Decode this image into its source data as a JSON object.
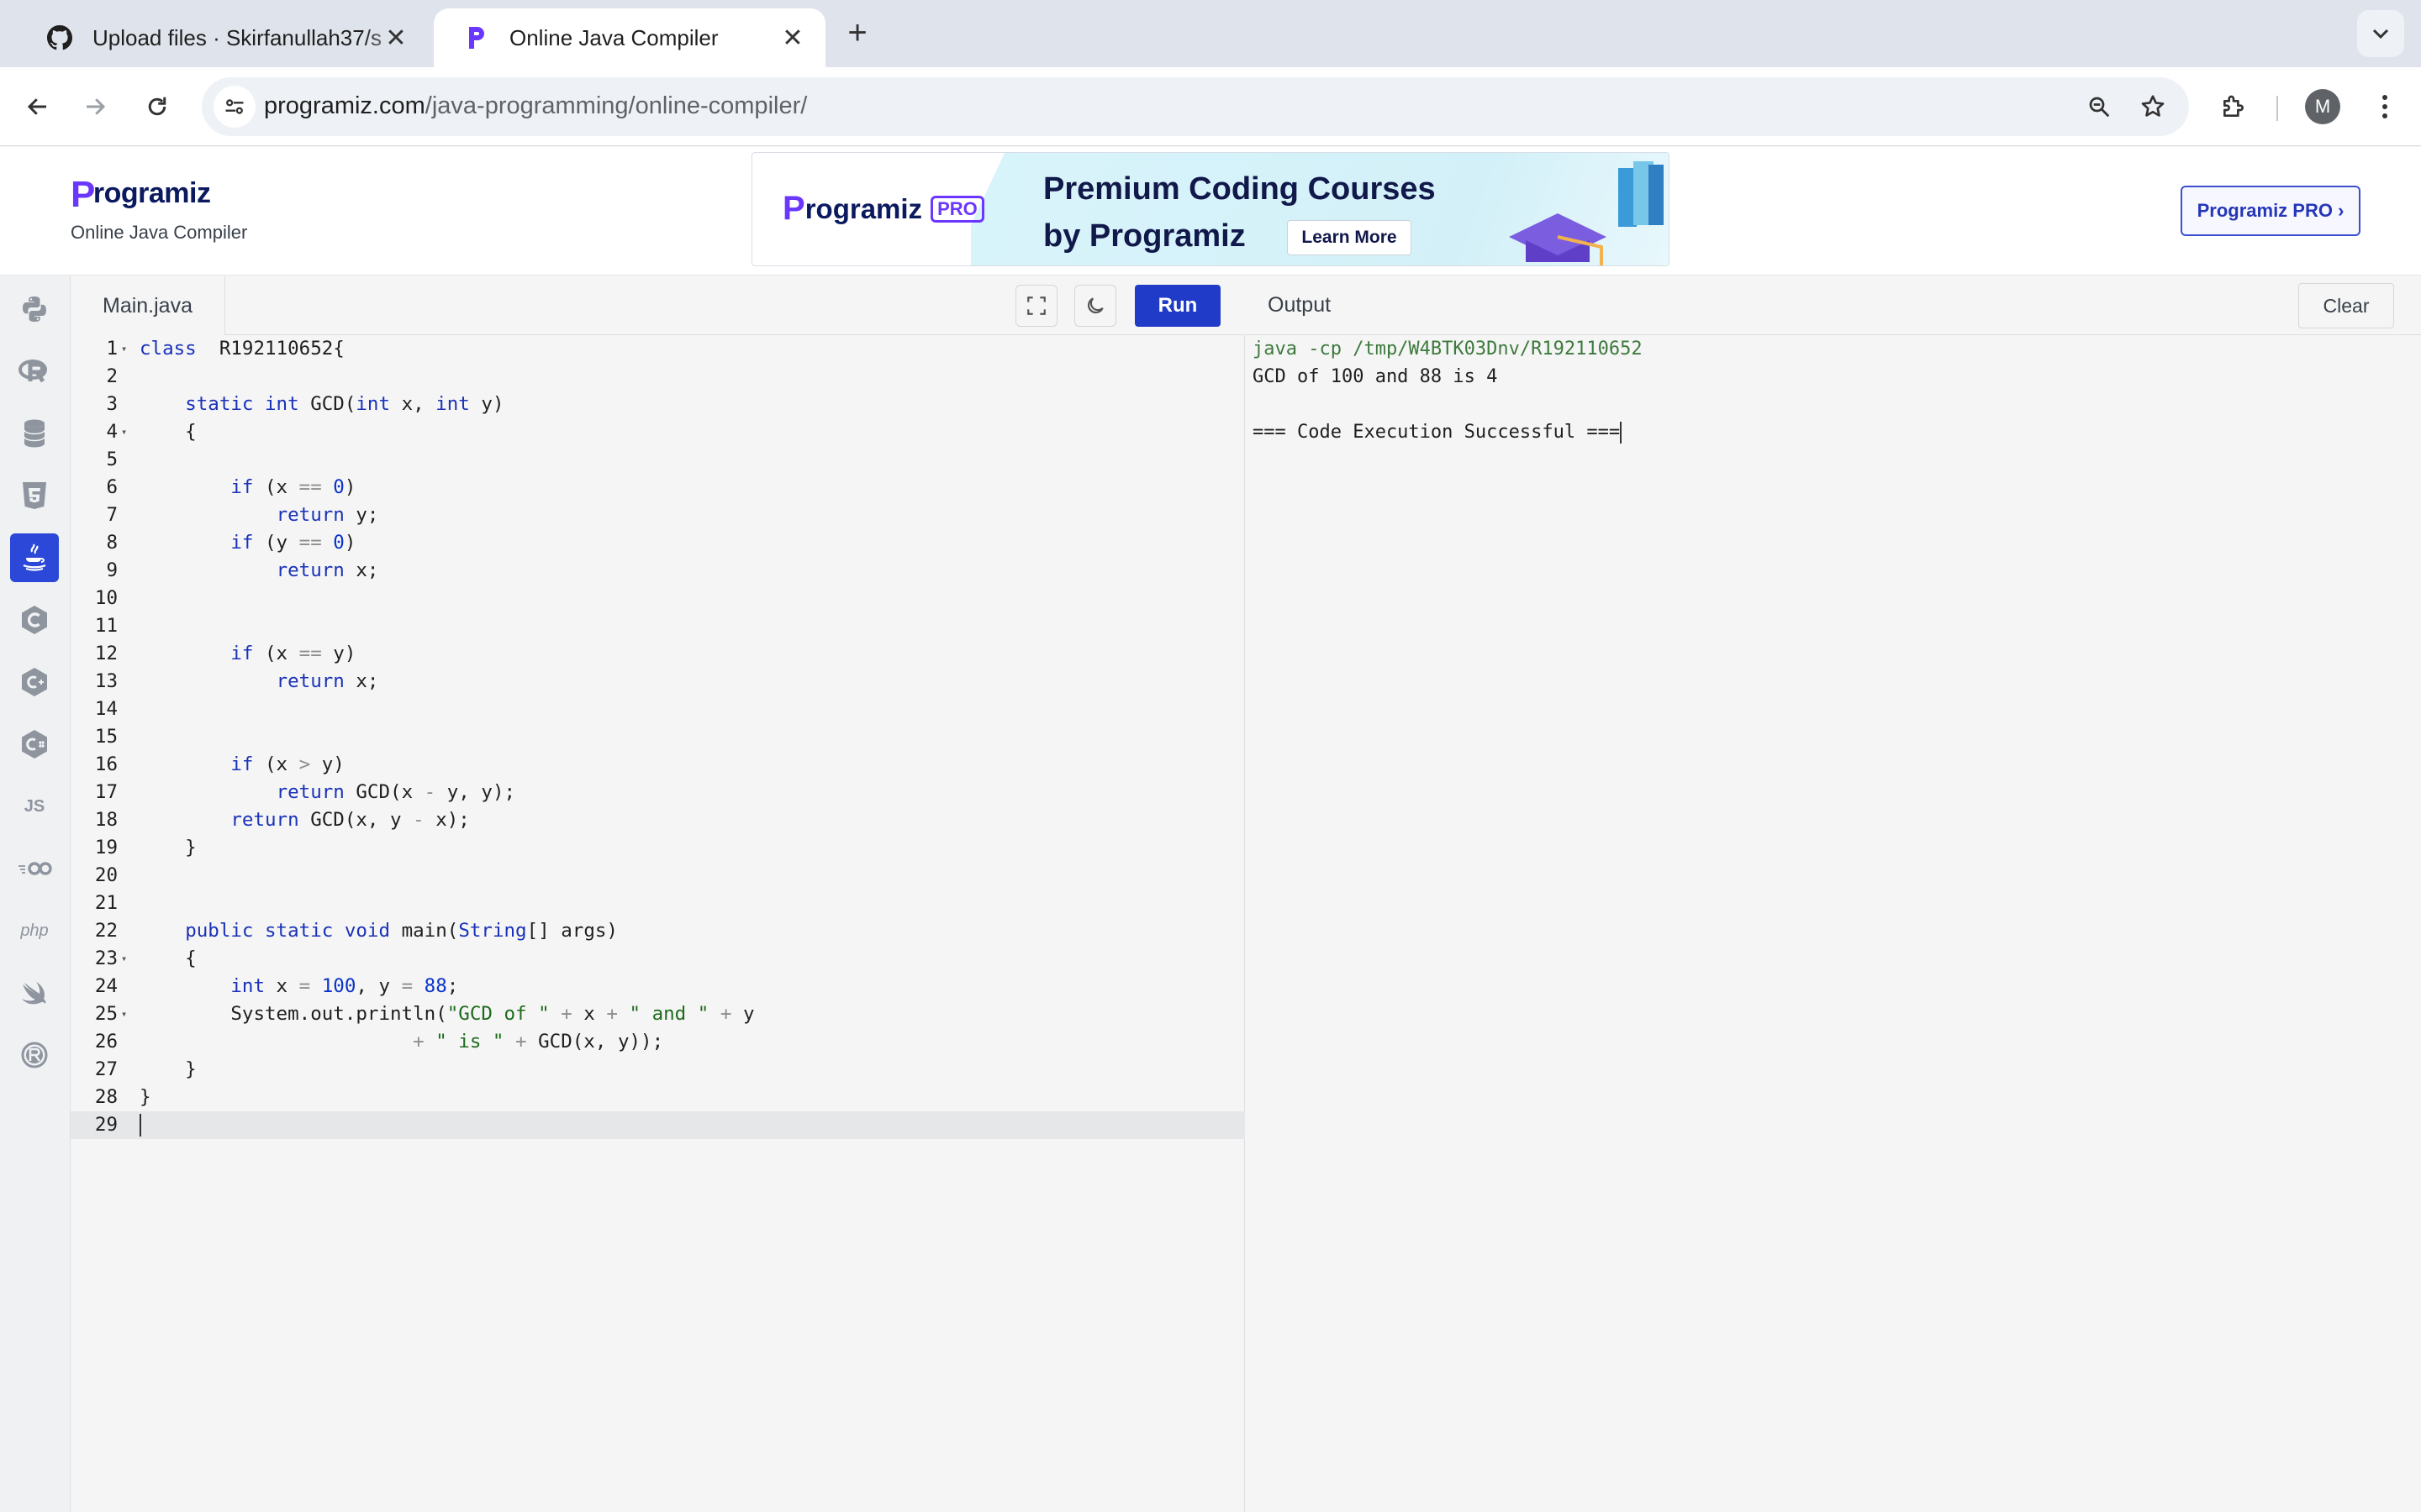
{
  "browser": {
    "tabs": [
      {
        "title": "Upload files · Skirfanullah37/s",
        "favicon": "github-icon",
        "active": false
      },
      {
        "title": "Online Java Compiler",
        "favicon": "programiz-icon",
        "active": true
      }
    ],
    "url_host": "programiz.com",
    "url_path": "/java-programming/online-compiler/",
    "avatar_initial": "M"
  },
  "header": {
    "logo_text": "rogramiz",
    "logo_letter": "P",
    "subtitle": "Online Java Compiler",
    "banner": {
      "logo_letter": "P",
      "logo_text": "rogramiz",
      "badge": "PRO",
      "line1": "Premium Coding Courses",
      "line2": "by Programiz",
      "cta": "Learn More"
    },
    "pro_button": "Programiz PRO ›"
  },
  "rail": [
    {
      "name": "python-icon",
      "glyph": "",
      "active": false
    },
    {
      "name": "r-icon",
      "glyph": "",
      "active": false
    },
    {
      "name": "sql-icon",
      "glyph": "",
      "active": false
    },
    {
      "name": "html5-icon",
      "glyph": "",
      "active": false
    },
    {
      "name": "java-icon",
      "glyph": "",
      "active": true
    },
    {
      "name": "c-icon",
      "glyph": "",
      "active": false
    },
    {
      "name": "cpp-icon",
      "glyph": "",
      "active": false
    },
    {
      "name": "csharp-icon",
      "glyph": "",
      "active": false
    },
    {
      "name": "javascript-icon",
      "glyph": "JS",
      "active": false
    },
    {
      "name": "go-icon",
      "glyph": "GO",
      "active": false
    },
    {
      "name": "php-icon",
      "glyph": "php",
      "active": false
    },
    {
      "name": "swift-icon",
      "glyph": "",
      "active": false
    },
    {
      "name": "rust-icon",
      "glyph": "",
      "active": false
    }
  ],
  "editor": {
    "file_name": "Main.java",
    "run_label": "Run",
    "code_lines": [
      "class  R192110652{",
      "",
      "    static int GCD(int x, int y)",
      "    {",
      "",
      "        if (x == 0)",
      "            return y;",
      "        if (y == 0)",
      "            return x;",
      "",
      "",
      "        if (x == y)",
      "            return x;",
      "",
      "",
      "        if (x > y)",
      "            return GCD(x - y, y);",
      "        return GCD(x, y - x);",
      "    }",
      "",
      "",
      "    public static void main(String[] args)",
      "    {",
      "        int x = 100, y = 88;",
      "        System.out.println(\"GCD of \" + x + \" and \" + y",
      "                        + \" is \" + GCD(x, y));",
      "    }",
      "}",
      ""
    ],
    "fold_lines": [
      1,
      4,
      23,
      25
    ],
    "current_line": 29
  },
  "output": {
    "title": "Output",
    "clear_label": "Clear",
    "lines": [
      "java -cp /tmp/W4BTK03Dnv/R192110652",
      "GCD of 100 and 88 is 4",
      "",
      "=== Code Execution Successful ==="
    ]
  }
}
